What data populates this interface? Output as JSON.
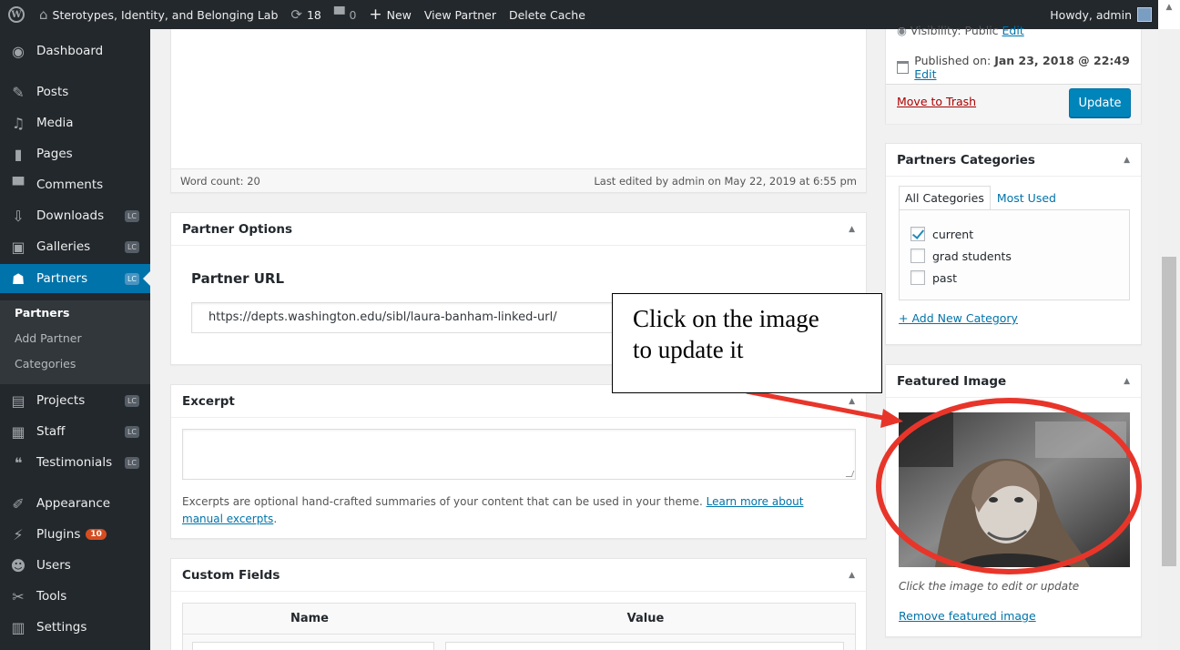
{
  "adminbar": {
    "site_name": "Sterotypes, Identity, and Belonging Lab",
    "updates_count": "18",
    "comments_count": "0",
    "new_label": "New",
    "view_label": "View Partner",
    "delete_cache_label": "Delete Cache",
    "howdy_label": "Howdy, admin"
  },
  "sidebar": {
    "items": [
      {
        "label": "Dashboard",
        "icon": "dashboard-icon"
      },
      {
        "label": "Posts",
        "icon": "pin-icon"
      },
      {
        "label": "Media",
        "icon": "media-icon"
      },
      {
        "label": "Pages",
        "icon": "pages-icon"
      },
      {
        "label": "Comments",
        "icon": "comment-icon"
      },
      {
        "label": "Downloads",
        "icon": "download-icon",
        "badge": "LC"
      },
      {
        "label": "Galleries",
        "icon": "gallery-icon",
        "badge": "LC"
      },
      {
        "label": "Partners",
        "icon": "groups-icon",
        "badge": "LC"
      },
      {
        "label": "Projects",
        "icon": "projects-icon",
        "badge": "LC"
      },
      {
        "label": "Staff",
        "icon": "id-card-icon",
        "badge": "LC"
      },
      {
        "label": "Testimonials",
        "icon": "quote-icon",
        "badge": "LC"
      },
      {
        "label": "Appearance",
        "icon": "brush-icon"
      },
      {
        "label": "Plugins",
        "icon": "plugin-icon",
        "count": "10"
      },
      {
        "label": "Users",
        "icon": "users-icon"
      },
      {
        "label": "Tools",
        "icon": "wrench-icon"
      },
      {
        "label": "Settings",
        "icon": "settings-icon"
      }
    ],
    "submenu": [
      "Partners",
      "Add Partner",
      "Categories"
    ]
  },
  "editor": {
    "word_count": "Word count: 20",
    "last_edited": "Last edited by admin on May 22, 2019 at 6:55 pm"
  },
  "partner_options": {
    "title": "Partner Options",
    "url_label": "Partner URL",
    "url_value": "https://depts.washington.edu/sibl/laura-banham-linked-url/"
  },
  "excerpt": {
    "title": "Excerpt",
    "help_text": "Excerpts are optional hand-crafted summaries of your content that can be used in your theme. ",
    "help_link": "Learn more about manual excerpts",
    "help_end": "."
  },
  "custom_fields": {
    "title": "Custom Fields",
    "col_name": "Name",
    "col_value": "Value"
  },
  "publish": {
    "visibility": "Visibility: Public",
    "visibility_edit": "Edit",
    "published_prefix": "Published on: ",
    "published_date": "Jan 23, 2018 @ 22:49",
    "published_edit": "Edit",
    "trash_label": "Move to Trash",
    "update_label": "Update"
  },
  "categories": {
    "title": "Partners Categories",
    "tab_all": "All Categories",
    "tab_used": "Most Used",
    "items": [
      {
        "label": "current",
        "checked": true
      },
      {
        "label": "grad students",
        "checked": false
      },
      {
        "label": "past",
        "checked": false
      }
    ],
    "add_new": "+ Add New Category"
  },
  "featured": {
    "title": "Featured Image",
    "caption": "Click the image to edit or update",
    "remove_label": "Remove featured image"
  },
  "annotation": {
    "line1": "Click on the image",
    "line2": "to update it",
    "color": "#e8352a"
  },
  "colors": {
    "admin_bar": "#23282d",
    "accent": "#0073aa",
    "button": "#0085ba",
    "trash": "#aa0000"
  }
}
